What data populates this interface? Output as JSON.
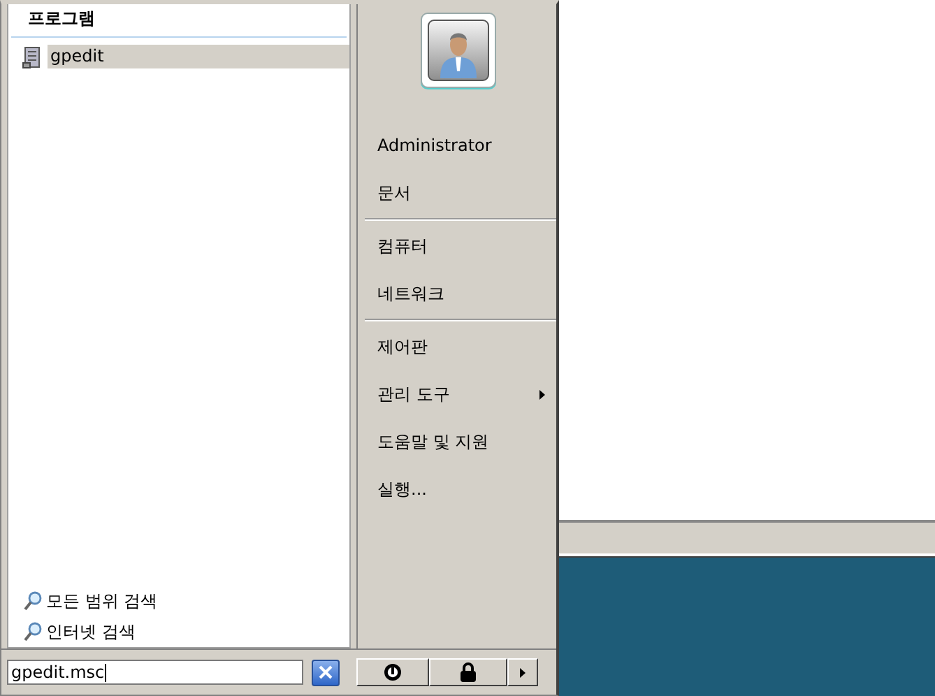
{
  "start_menu": {
    "programs": {
      "heading": "프로그램",
      "items": [
        {
          "label": "gpedit",
          "selected": true
        }
      ]
    },
    "search_links": [
      {
        "label": "모든 범위 검색"
      },
      {
        "label": "인터넷 검색"
      }
    ],
    "search": {
      "value": "gpedit.msc"
    },
    "right_items": [
      {
        "kind": "item",
        "label": "Administrator",
        "submenu": false
      },
      {
        "kind": "item",
        "label": "문서",
        "submenu": false
      },
      {
        "kind": "separator"
      },
      {
        "kind": "item",
        "label": "컴퓨터",
        "submenu": false
      },
      {
        "kind": "item",
        "label": "네트워크",
        "submenu": false
      },
      {
        "kind": "separator"
      },
      {
        "kind": "item",
        "label": "제어판",
        "submenu": false
      },
      {
        "kind": "item",
        "label": "관리 도구",
        "submenu": true
      },
      {
        "kind": "item",
        "label": "도움말 및 지원",
        "submenu": false
      },
      {
        "kind": "item",
        "label": "실행...",
        "submenu": false
      }
    ]
  }
}
